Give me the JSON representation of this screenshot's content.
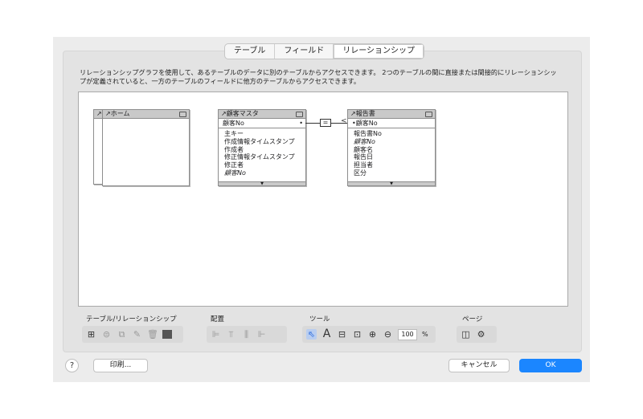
{
  "tabs": [
    "テーブル",
    "フィールド",
    "リレーションシップ"
  ],
  "description": "リレーションシップグラフを使用して、あるテーブルのデータに別のテーブルからアクセスできます。 2つのテーブルの間に直接または間接的にリレーションシップが定義されていると、一方のテーブルのフィールドに他方のテーブルからアクセスできます。",
  "tables": {
    "home": {
      "title": "ホーム",
      "back_title": ""
    },
    "customer": {
      "title": "顧客マスタ",
      "key": "顧客No",
      "fields": [
        "主キー",
        "作成情報タイムスタンプ",
        "作成者",
        "修正情報タイムスタンプ",
        "修正者",
        "顧客No"
      ]
    },
    "report": {
      "title": "報告書",
      "key": "顧客No",
      "fields": [
        "報告書No",
        "顧客No",
        "顧客名",
        "報告日",
        "担当者",
        "区分"
      ]
    }
  },
  "toolbar": {
    "table_rel_label": "テーブル/リレーションシップ",
    "arrange_label": "配置",
    "tools_label": "ツール",
    "page_label": "ページ",
    "zoom_value": "100",
    "zoom_unit": "%"
  },
  "buttons": {
    "help": "?",
    "print": "印刷...",
    "cancel": "キャンセル",
    "ok": "OK"
  },
  "colors": {
    "accent": "#1b86ff",
    "active_tool": "#2f6fde"
  }
}
